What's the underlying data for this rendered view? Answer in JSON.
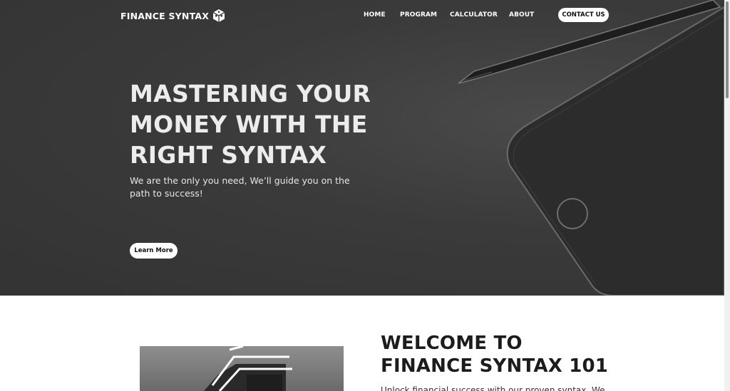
{
  "nav": {
    "logo_text": "FINANCE SYNTAX",
    "links": [
      "HOME",
      "PROGRAM",
      "CALCULATOR",
      "ABOUT"
    ],
    "contact_label": "CONTACT US"
  },
  "hero": {
    "title_lines": [
      "MASTERING YOUR",
      "MONEY WITH THE",
      "RIGHT SYNTAX"
    ],
    "subtitle": "We are the only you need, We’ll guide you on the path to success!",
    "cta_label": "Learn More"
  },
  "about": {
    "title_lines": [
      "WELCOME TO",
      "FINANCE SYNTAX 101"
    ],
    "text": "Unlock financial success with our proven syntax. We"
  },
  "colors": {
    "hero_bg": "#3a3a3a",
    "button_bg": "#ffffff",
    "heading_dark": "#1c1c1c"
  },
  "icons": {
    "logo": "cube-icon"
  }
}
